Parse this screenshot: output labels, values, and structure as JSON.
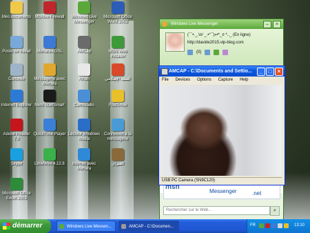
{
  "desktop": {
    "icons": [
      {
        "label": "Mes documents",
        "icon": "folder-icon",
        "color": "#f0c84a"
      },
      {
        "label": "McAfee Firewall",
        "icon": "shield-icon",
        "color": "#c0272d"
      },
      {
        "label": "Windows Live Messenger",
        "icon": "messenger-icon",
        "color": "#5aa83a"
      },
      {
        "label": "Microsoft Office Word 2003",
        "icon": "word-icon",
        "color": "#2b5cb8"
      },
      {
        "label": "Poste de travail",
        "icon": "computer-icon",
        "color": "#7aa8d8"
      },
      {
        "label": "Menara ADSL",
        "icon": "network-icon",
        "color": "#3c7ad6"
      },
      {
        "label": "AMCap",
        "icon": "camera-icon",
        "color": "#6b6b6b"
      },
      {
        "label": "MSN Web Installer",
        "icon": "msn-icon",
        "color": "#3d9a38"
      },
      {
        "label": "Corbeille",
        "icon": "recycle-bin-icon",
        "color": "#9fb4c8"
      },
      {
        "label": "Messagerie avec Menara",
        "icon": "mail-icon",
        "color": "#e0a82e"
      },
      {
        "label": "Athan",
        "icon": "mosque-icon",
        "color": "#e8e8e8"
      },
      {
        "label": "المنبه الإسلامي",
        "icon": "alarm-icon",
        "color": "#d84a2a"
      },
      {
        "label": "Internet Explorer",
        "icon": "ie-icon",
        "color": "#2c7ad6"
      },
      {
        "label": "Nero StartSmart",
        "icon": "nero-icon",
        "color": "#1a1a1a"
      },
      {
        "label": "CamStudio",
        "icon": "camstudio-icon",
        "color": "#4a8fd6"
      },
      {
        "label": "PostSmile",
        "icon": "smile-icon",
        "color": "#e8c02a"
      },
      {
        "label": "Adobe Reader 7.0",
        "icon": "pdf-icon",
        "color": "#c4161c"
      },
      {
        "label": "QuickTime Player",
        "icon": "quicktime-icon",
        "color": "#3b7fd6"
      },
      {
        "label": "Lecteur Windows Media",
        "icon": "media-player-icon",
        "color": "#2a6ec8"
      },
      {
        "label": "Connexion à la messagerie",
        "icon": "mail-connect-icon",
        "color": "#4a9ad6"
      },
      {
        "label": "Skype",
        "icon": "skype-icon",
        "color": "#1aa0e0"
      },
      {
        "label": "LimeWire 4.12.6",
        "icon": "limewire-icon",
        "color": "#3ab14a"
      },
      {
        "label": "Internet avec Menara",
        "icon": "globe-icon",
        "color": "#2e8ad6"
      },
      {
        "label": "الميزان",
        "icon": "book-icon",
        "color": "#8a6a3a"
      },
      {
        "label": "Microsoft Office Excel 2003",
        "icon": "excel-icon",
        "color": "#2e8b3a"
      }
    ]
  },
  "messenger": {
    "title": "Windows Live Messenger",
    "username": "(¯`•._.\\¤/ _.•°¯)»•*_¤ *.._  (En ligne)",
    "url": "http://davide2015.vip-blog.com",
    "mail_count": "(0)",
    "banner_main": "msn",
    "banner_sub": "Messenger",
    "banner_net": ".net",
    "search_placeholder": "Rechercher sur le Web..."
  },
  "amcap": {
    "title": "AMCAP - C:\\Documents and Settio...",
    "menu": [
      "File",
      "Devices",
      "Options",
      "Capture",
      "Help"
    ],
    "status": "USB PC Camera (SN9C120)"
  },
  "taskbar": {
    "start_label": "démarrer",
    "tasks": [
      {
        "label": "Windows Live Messen...",
        "active": false,
        "color": "#5aa83a"
      },
      {
        "label": "AMCAP - C:\\Documen...",
        "active": true,
        "color": "#9a9a9a"
      }
    ],
    "language": "FR",
    "clock": "13:10"
  }
}
